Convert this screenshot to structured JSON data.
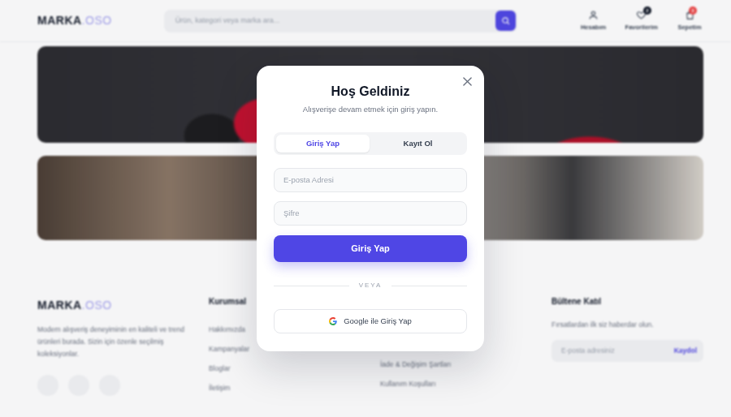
{
  "header": {
    "logo": {
      "main": "MARKA",
      "accent": ".OSO"
    },
    "search": {
      "placeholder": "Ürün, kategori veya marka ara..."
    },
    "actions": [
      {
        "label": "Hesabım"
      },
      {
        "label": "Favorilerim",
        "badge": "2"
      },
      {
        "label": "Sepetim",
        "badge": "3"
      }
    ]
  },
  "footer": {
    "logo": {
      "main": "MARKA",
      "accent": ".OSO"
    },
    "description": "Modern alışveriş deneyiminin en kaliteli ve trend ürünleri burada. Sizin için özenle seçilmiş koleksiyonlar.",
    "columns": [
      {
        "title": "Kurumsal",
        "links": [
          "Hakkımızda",
          "Kampanyalar",
          "Bloglar",
          "İletişim"
        ]
      },
      {
        "links": [
          "İade & Değişim Şartları",
          "Kullanım Koşulları"
        ]
      }
    ],
    "newsletter": {
      "title": "Bültene Katıl",
      "text": "Fırsatlardan ilk siz haberdar olun.",
      "placeholder": "E-posta adresiniz",
      "button": "Kaydol"
    }
  },
  "modal": {
    "title": "Hoş Geldiniz",
    "subtitle": "Alışverişe devam etmek için giriş yapın.",
    "tabs": [
      {
        "label": "Giriş Yap",
        "selected": true
      },
      {
        "label": "Kayıt Ol",
        "selected": false
      }
    ],
    "fields": [
      {
        "placeholder": "E-posta Adresi",
        "kind": "email"
      },
      {
        "placeholder": "Şifre",
        "kind": "password"
      }
    ],
    "submit": "Giriş Yap",
    "divider": "VEYA",
    "google": "Google ile Giriş Yap"
  }
}
